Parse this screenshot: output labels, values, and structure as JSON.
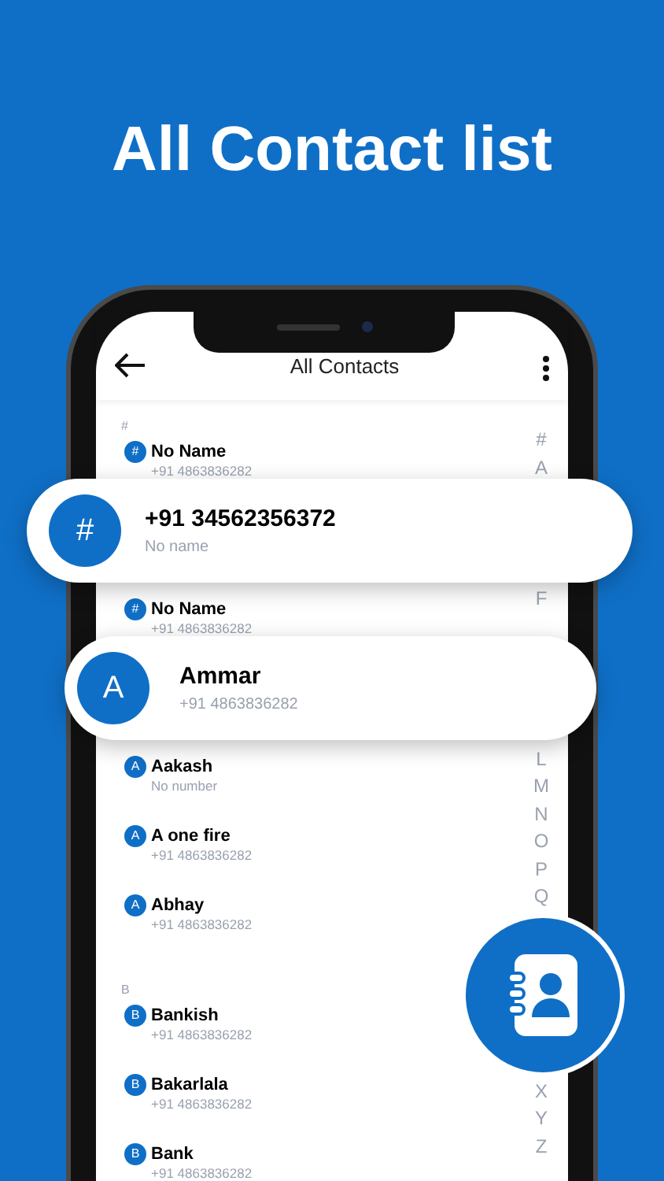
{
  "headline": "All Contact list",
  "app_bar": {
    "title": "All Contacts"
  },
  "list": [
    {
      "kind": "section",
      "label": "#"
    },
    {
      "kind": "contact",
      "badge": "#",
      "title": "No Name",
      "subtitle": "+91 4863836282"
    },
    {
      "kind": "card",
      "badge": "#",
      "title": "+91 34562356372",
      "subtitle": "No name"
    },
    {
      "kind": "contact",
      "badge": "#",
      "title": "No Name",
      "subtitle": "+91 4863836282"
    },
    {
      "kind": "card",
      "badge": "A",
      "title": "Ammar",
      "subtitle": "+91 4863836282"
    },
    {
      "kind": "contact",
      "badge": "A",
      "title": "Aakash",
      "subtitle": "No number"
    },
    {
      "kind": "contact",
      "badge": "A",
      "title": "A one fire",
      "subtitle": "+91 4863836282"
    },
    {
      "kind": "contact",
      "badge": "A",
      "title": "Abhay",
      "subtitle": "+91 4863836282"
    },
    {
      "kind": "section",
      "label": "B"
    },
    {
      "kind": "contact",
      "badge": "B",
      "title": "Bankish",
      "subtitle": "+91 4863836282"
    },
    {
      "kind": "contact",
      "badge": "B",
      "title": "Bakarlala",
      "subtitle": "+91 4863836282"
    },
    {
      "kind": "contact",
      "badge": "B",
      "title": "Bank",
      "subtitle": "+91 4863836282"
    }
  ],
  "index_groups": [
    [
      "#",
      "A"
    ],
    [
      "F"
    ],
    [
      "L",
      "M",
      "N",
      "O",
      "P",
      "Q"
    ],
    [
      "X",
      "Y",
      "Z"
    ]
  ]
}
